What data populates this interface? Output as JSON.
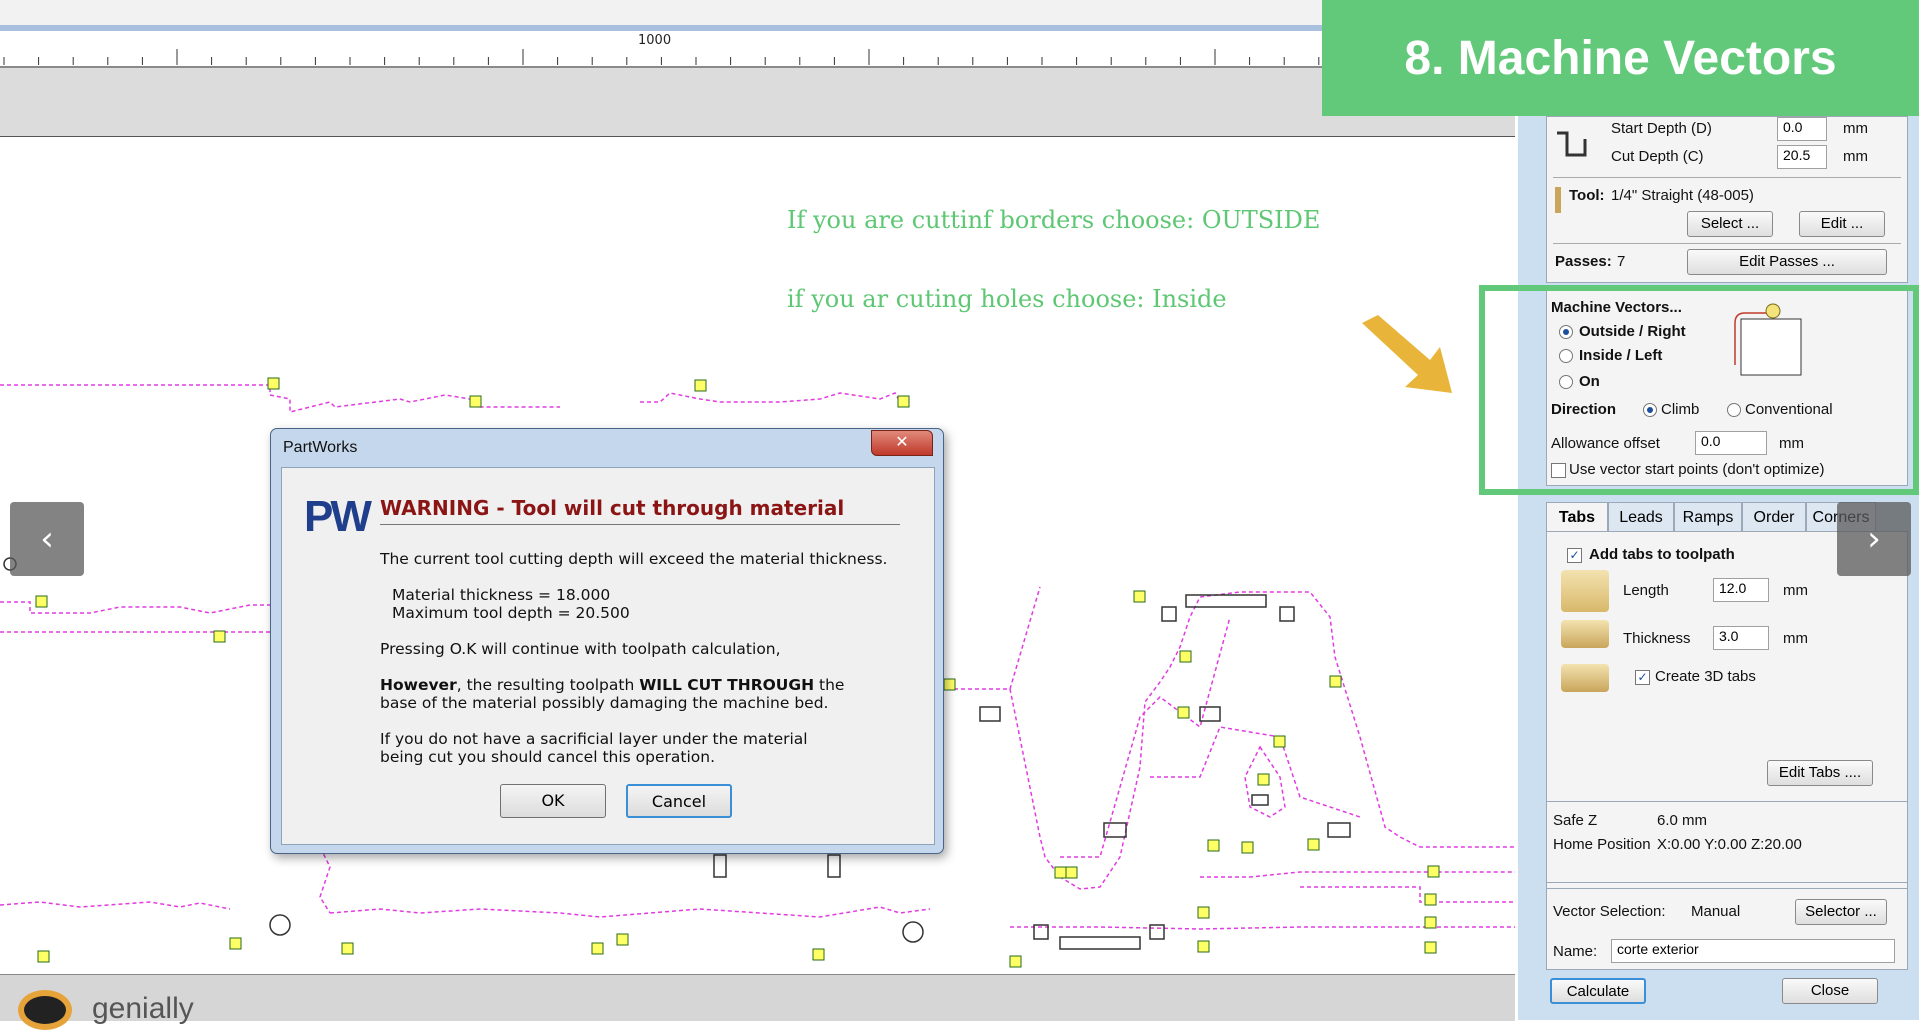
{
  "ruler": {
    "label": "1000"
  },
  "title_banner": "8. Machine Vectors",
  "notes": {
    "line1": "If you are cuttinf  borders choose: OUTSIDE",
    "line2": "if you ar cuting holes choose: Inside"
  },
  "dialog": {
    "title": "PartWorks",
    "close_label": "✕",
    "logo": "PW",
    "heading": "WARNING - Tool will cut through material",
    "para1": "The current tool cutting depth will exceed the material thickness.",
    "material_thickness": "Material thickness = 18.000",
    "max_depth": "Maximum tool depth = 20.500",
    "para2": "Pressing O.K will continue with toolpath calculation,",
    "para3_bold1": "However",
    "para3_a": ", the resulting toolpath ",
    "para3_bold2": "WILL CUT THROUGH",
    "para3_b": " the",
    "para3_line2": "base of the material possibly damaging the machine bed.",
    "para4_line1": "If you do not have a sacrificial layer under the material",
    "para4_line2": "being cut you should cancel this operation.",
    "ok_label": "OK",
    "cancel_label": "Cancel"
  },
  "panel": {
    "start_depth_label": "Start Depth (D)",
    "start_depth_value": "0.0",
    "cut_depth_label": "Cut Depth (C)",
    "cut_depth_value": "20.5",
    "unit": "mm",
    "tool_label": "Tool:",
    "tool_value": "1/4\" Straight  (48-005)",
    "select_label": "Select ...",
    "edit_label": "Edit ...",
    "passes_label": "Passes:",
    "passes_value": "7",
    "edit_passes_label": "Edit Passes ...",
    "machine_vectors_label": "Machine Vectors...",
    "outside_label": "Outside / Right",
    "inside_label": "Inside / Left",
    "on_label": "On",
    "direction_label": "Direction",
    "climb_label": "Climb",
    "conventional_label": "Conventional",
    "allowance_label": "Allowance offset",
    "allowance_value": "0.0",
    "use_vector_label": "Use vector start points (don't optimize)",
    "tabs": [
      "Tabs",
      "Leads",
      "Ramps",
      "Order",
      "Corners"
    ],
    "add_tabs_label": "Add tabs to toolpath",
    "length_label": "Length",
    "length_value": "12.0",
    "thickness_label": "Thickness",
    "thickness_value": "3.0",
    "create_3d_label": "Create 3D tabs",
    "edit_tabs_label": "Edit Tabs ....",
    "safe_z_label": "Safe Z",
    "safe_z_value": "6.0 mm",
    "home_label": "Home Position",
    "home_value": "X:0.00 Y:0.00 Z:20.00",
    "vector_selection_label": "Vector Selection:",
    "vector_selection_value": "Manual",
    "selector_label": "Selector ...",
    "name_label": "Name:",
    "name_value": "corte exterior",
    "calculate_label": "Calculate",
    "close_label": "Close"
  },
  "footer": {
    "logo_text": "genially"
  },
  "colors": {
    "accent_green": "#63c97a",
    "warning_red": "#8b1414",
    "toolpath_magenta": "#e23be0"
  },
  "icons": {
    "prev": "chevron-left-icon",
    "next": "chevron-right-icon",
    "arrow": "arrow-down-right-icon"
  }
}
